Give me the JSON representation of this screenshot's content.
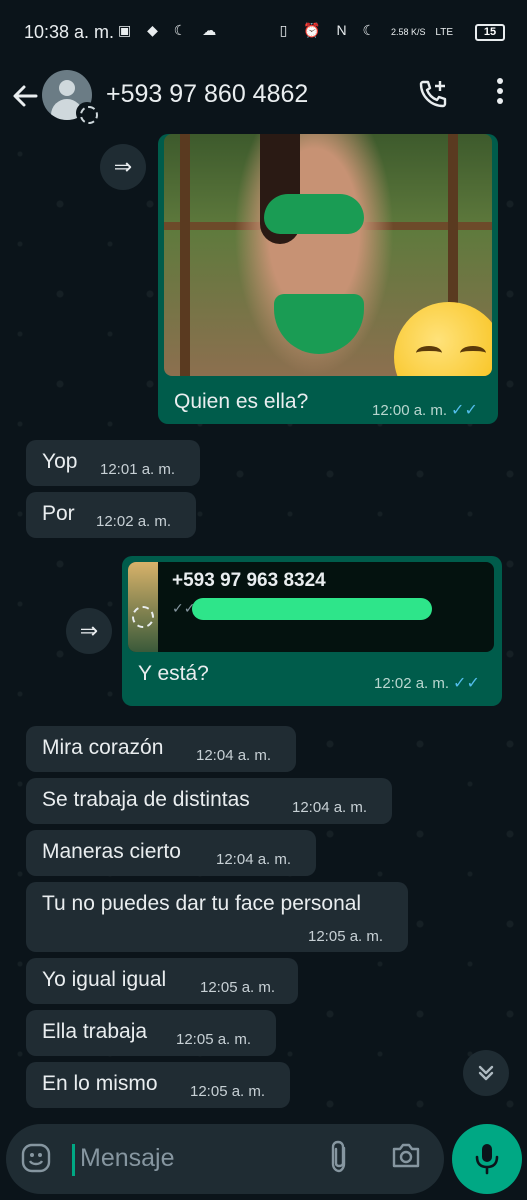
{
  "status_bar": {
    "time": "10:38 a. m.",
    "left_icons": "▣ ◆ ☾ ☁",
    "right_icons": "▯ ⏰ N ☾",
    "speed": "2.58 K/S",
    "network": "LTE",
    "battery": "15",
    "battery_percent": 15
  },
  "header": {
    "contact_name": "+593 97 860 4862",
    "back_icon": "arrow-left-icon",
    "call_icon": "add-call-icon",
    "menu_icon": "more-vert-icon"
  },
  "messages": [
    {
      "dir": "out",
      "type": "image",
      "text": "Quien es ella?",
      "time": "12:00 a. m.",
      "ticks": "✓✓"
    },
    {
      "dir": "in",
      "text": "Yop",
      "time": "12:01 a. m."
    },
    {
      "dir": "in",
      "text": "Por",
      "time": "12:02 a. m."
    },
    {
      "dir": "out",
      "type": "reply",
      "reply_title": "+593 97 963 8324",
      "reply_ticks": "✓✓",
      "text": "Y está?",
      "time": "12:02 a. m.",
      "ticks": "✓✓"
    },
    {
      "dir": "in",
      "text": "Mira corazón",
      "time": "12:04 a. m."
    },
    {
      "dir": "in",
      "text": "Se trabaja de distintas",
      "time": "12:04 a. m."
    },
    {
      "dir": "in",
      "text": "Maneras cierto",
      "time": "12:04 a. m."
    },
    {
      "dir": "in",
      "text": "Tu no puedes dar tu face personal",
      "time": "12:05 a. m."
    },
    {
      "dir": "in",
      "text": "Yo igual igual",
      "time": "12:05 a. m."
    },
    {
      "dir": "in",
      "text": "Ella trabaja",
      "time": "12:05 a. m."
    },
    {
      "dir": "in",
      "text": "En lo mismo",
      "time": "12:05 a. m."
    }
  ],
  "composer": {
    "placeholder": "Mensaje",
    "emoji_icon": "emoji-icon",
    "attach_icon": "attach-icon",
    "camera_icon": "camera-icon",
    "mic_icon": "mic-icon"
  },
  "colors": {
    "background": "#0b141a",
    "incoming_bubble": "#202c33",
    "outgoing_bubble": "#005c4b",
    "accent": "#00a884",
    "read_ticks": "#53bdeb"
  }
}
